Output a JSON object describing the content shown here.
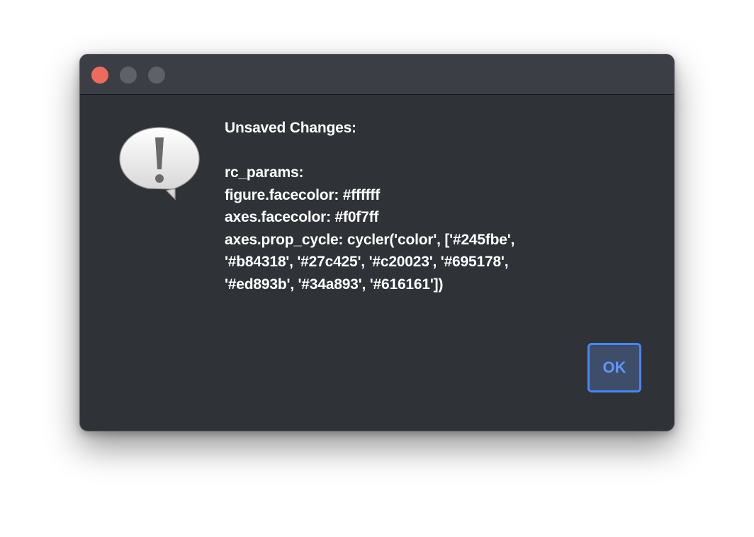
{
  "dialog": {
    "message_lines": [
      "Unsaved Changes:",
      "",
      "rc_params:",
      "figure.facecolor: #ffffff",
      "axes.facecolor: #f0f7ff",
      "axes.prop_cycle: cycler('color', ['#245fbe',",
      "'#b84318', '#27c425', '#c20023', '#695178',",
      "'#ed893b', '#34a893', '#616161'])"
    ],
    "ok_label": "OK",
    "icon": "alert-speech-bubble-icon"
  },
  "colors": {
    "window_bg": "#2f3237",
    "titlebar_bg": "#3b3e44",
    "close": "#ec6a5e",
    "inactive_control": "#5e6166",
    "accent": "#4a86f0",
    "text": "#ffffff"
  }
}
